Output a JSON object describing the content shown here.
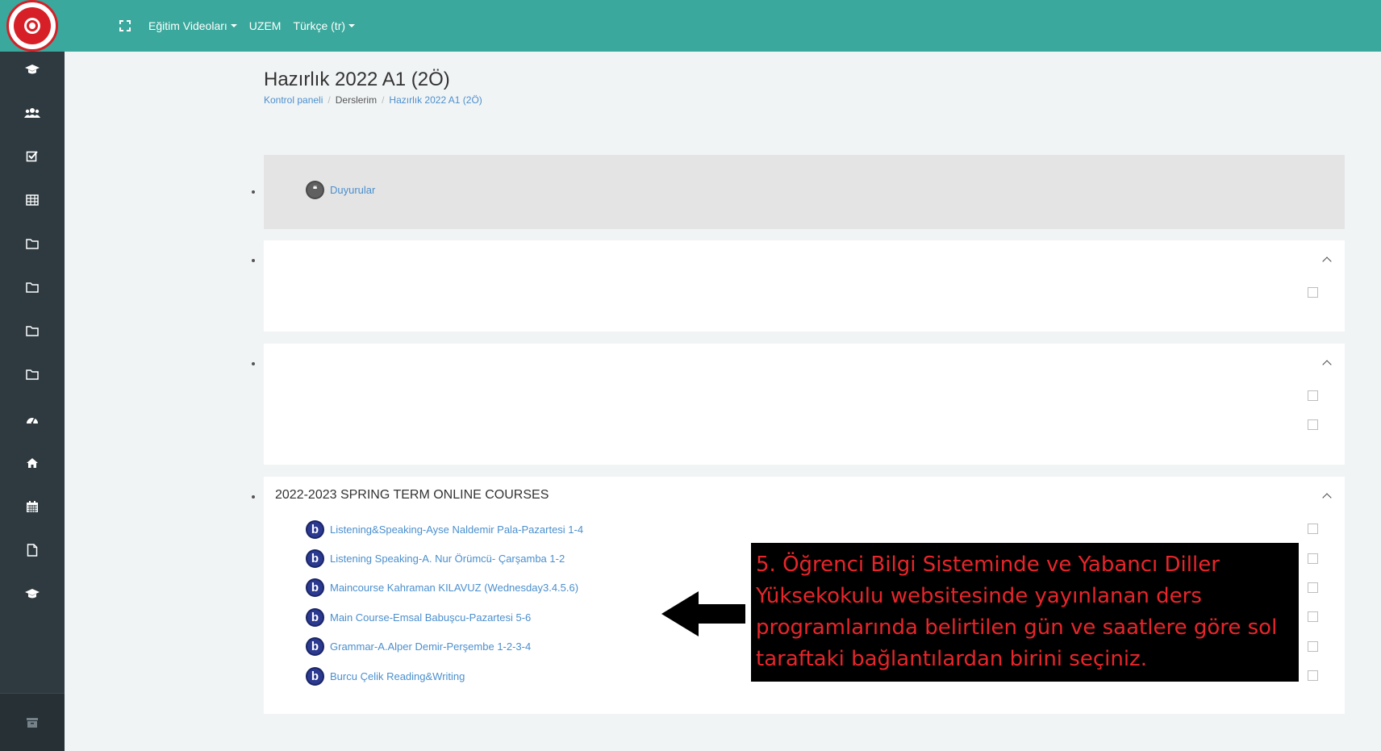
{
  "navbar": {
    "nav_links": [
      {
        "label": "Eğitim Videoları",
        "has_caret": true
      },
      {
        "label": "UZEM",
        "has_caret": false
      },
      {
        "label": "Türkçe (tr)",
        "has_caret": true
      }
    ]
  },
  "sidebar": {
    "items": [
      {
        "icon": "graduation-cap-icon"
      },
      {
        "icon": "users-icon"
      },
      {
        "icon": "check-square-icon"
      },
      {
        "icon": "table-icon"
      },
      {
        "icon": "folder-icon"
      },
      {
        "icon": "folder-icon"
      },
      {
        "icon": "folder-icon"
      },
      {
        "icon": "folder-icon"
      },
      {
        "icon": "dashboard-icon"
      },
      {
        "icon": "home-icon"
      },
      {
        "icon": "calendar-icon"
      },
      {
        "icon": "file-icon"
      },
      {
        "icon": "graduation-cap-icon"
      }
    ],
    "bottom_icon": "archive-icon"
  },
  "page": {
    "title": "Hazırlık 2022 A1 (2Ö)",
    "breadcrumb": [
      "Kontrol paneli",
      "Derslerim",
      "Hazırlık 2022 A1 (2Ö)"
    ]
  },
  "sections": {
    "general": {
      "activities": [
        {
          "label": "Duyurular",
          "icon": "forum-icon"
        }
      ]
    },
    "spring": {
      "title": "2022-2023 SPRING TERM ONLINE COURSES",
      "activities": [
        {
          "label": "Listening&Speaking-Ayse Naldemir Pala-Pazartesi 1-4"
        },
        {
          "label": "Listening Speaking-A. Nur Örümcü- Çarşamba 1-2"
        },
        {
          "label": "Maincourse Kahraman KILAVUZ (Wednesday3.4.5.6)"
        },
        {
          "label": "Main Course-Emsal Babuşcu-Pazartesi 5-6"
        },
        {
          "label": "Grammar-A.Alper Demir-Perşembe 1-2-3-4"
        },
        {
          "label": "Burcu Çelik Reading&Writing"
        }
      ]
    }
  },
  "annotation": {
    "text": "5. Öğrenci Bilgi Sisteminde ve Yabancı Diller Yüksekokulu websitesinde yayınlanan ders programlarında belirtilen gün ve saatlere göre sol taraftaki bağlantılardan birini seçiniz.",
    "color": "#e8252a",
    "background": "#000000"
  },
  "colors": {
    "navbar": "#3aa89c",
    "sidebar": "#2e3a40",
    "link": "#4b8fcd",
    "bbb_icon": "#2b3990"
  }
}
